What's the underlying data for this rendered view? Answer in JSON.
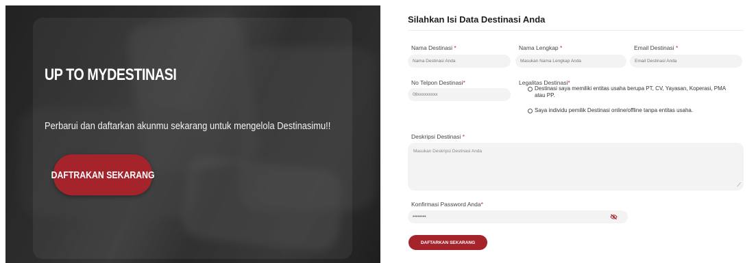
{
  "hero": {
    "title": "UP TO MYDESTINASI",
    "subtitle": "Perbarui dan daftarkan akunmu sekarang untuk mengelola Destinasimu!!",
    "button_label": "DAFTRAKAN SEKARANG"
  },
  "form": {
    "title": "Silahkan Isi Data Destinasi Anda",
    "nama_destinasi": {
      "label": "Nama Destinasi ",
      "placeholder": "Nama Destinasi Anda"
    },
    "nama_lengkap": {
      "label": "Nama Lengkap ",
      "placeholder": "Masukan Nama Lengkap Anda"
    },
    "email": {
      "label": "Email Destinasi ",
      "placeholder": "Email Destinasi Anda"
    },
    "telpon": {
      "label": "No Telpon Destinasi",
      "placeholder": "08xxxxxxxxx"
    },
    "legalitas": {
      "label": "Legalitas Destinasi",
      "option1": "Destinasi saya memiliki entitas usaha berupa PT, CV, Yayasan, Koperasi, PMA atau PP.",
      "option2": "Saya individu pemilik Destinasi online/offline tanpa entitas usaha."
    },
    "deskripsi": {
      "label": "Deskripsi Destinasi ",
      "placeholder": "Masukan Deskripsi Destinasi Anda"
    },
    "password": {
      "label": "Konfirmasi Password Anda",
      "value": "••••••••"
    },
    "required_mark": "*",
    "submit_label": "DAFTARKAN SEKARANG"
  },
  "colors": {
    "accent": "#a5242c",
    "required": "#c0262f"
  },
  "icons": {
    "password_toggle": "eye-slash-icon"
  }
}
